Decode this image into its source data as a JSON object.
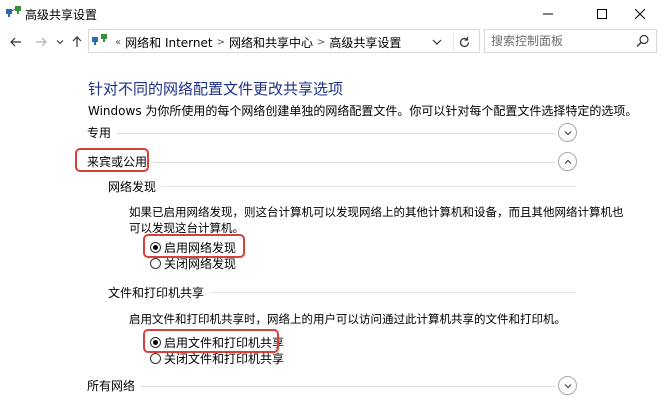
{
  "window": {
    "title": "高级共享设置"
  },
  "nav": {
    "breadcrumbs": [
      "网络和 Internet",
      "网络和共享中心",
      "高级共享设置"
    ],
    "search_placeholder": "搜索控制面板"
  },
  "page": {
    "heading": "针对不同的网络配置文件更改共享选项",
    "subtitle": "Windows 为你所使用的每个网络创建单独的网络配置文件。你可以针对每个配置文件选择特定的选项。"
  },
  "profiles": {
    "private_label": "专用",
    "guest_label": "来宾或公用",
    "all_label": "所有网络"
  },
  "discovery": {
    "heading": "网络发现",
    "description_line1": "如果已启用网络发现，则这台计算机可以发现网络上的其他计算机和设备，而且其他网络计算机也",
    "description_line2": "可以发现这台计算机。",
    "option_on": "启用网络发现",
    "option_off": "关闭网络发现",
    "selected": "on"
  },
  "file_sharing": {
    "heading": "文件和打印机共享",
    "description": "启用文件和打印机共享时，网络上的用户可以访问通过此计算机共享的文件和打印机。",
    "option_on": "启用文件和打印机共享",
    "option_off": "关闭文件和打印机共享",
    "selected": "on"
  },
  "colors": {
    "heading": "#1e3287",
    "highlight": "#d8413b"
  }
}
